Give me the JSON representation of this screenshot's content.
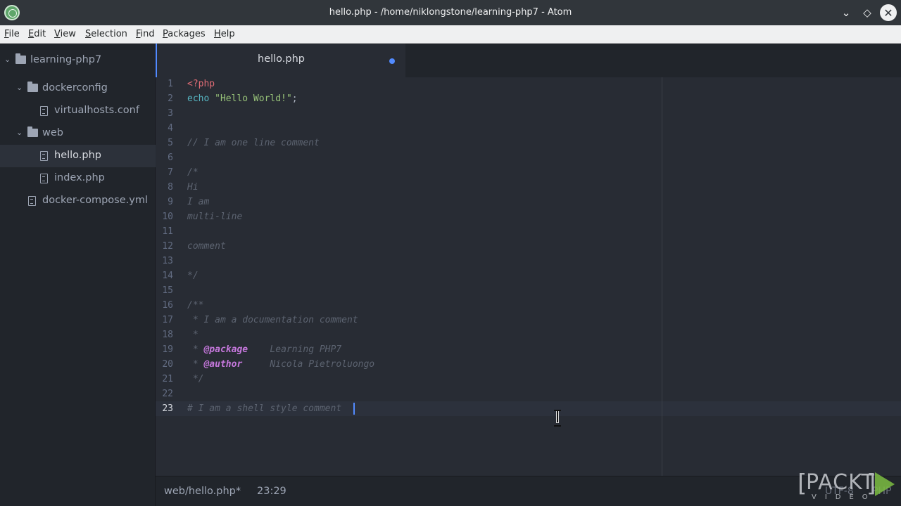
{
  "window": {
    "title": "hello.php - /home/niklongstone/learning-php7 - Atom",
    "buttons": {
      "minimize": "⌄",
      "maximize": "◇",
      "close": "✕"
    }
  },
  "menu": [
    {
      "label": "File",
      "underline": "F",
      "rest": "ile"
    },
    {
      "label": "Edit",
      "underline": "E",
      "rest": "dit"
    },
    {
      "label": "View",
      "underline": "V",
      "rest": "iew"
    },
    {
      "label": "Selection",
      "underline": "S",
      "rest": "election"
    },
    {
      "label": "Find",
      "underline": "F",
      "rest": "ind"
    },
    {
      "label": "Packages",
      "underline": "P",
      "rest": "ackages"
    },
    {
      "label": "Help",
      "underline": "H",
      "rest": "elp"
    }
  ],
  "tree": {
    "items": [
      {
        "label": "learning-php7",
        "type": "folder",
        "expanded": true,
        "icon": "folder-icon"
      },
      {
        "label": "dockerconfig",
        "type": "folder",
        "expanded": true,
        "icon": "folder-icon"
      },
      {
        "label": "virtualhosts.conf",
        "type": "file",
        "icon": "file-icon"
      },
      {
        "label": "web",
        "type": "folder",
        "expanded": true,
        "icon": "folder-icon"
      },
      {
        "label": "hello.php",
        "type": "file",
        "selected": true,
        "icon": "file-icon"
      },
      {
        "label": "index.php",
        "type": "file",
        "icon": "file-icon"
      },
      {
        "label": "docker-compose.yml",
        "type": "file",
        "icon": "file-icon"
      }
    ]
  },
  "tab": {
    "label": "hello.php",
    "modified": true
  },
  "editor": {
    "active_line": 23,
    "line_numbers": [
      "1",
      "2",
      "3",
      "4",
      "5",
      "6",
      "7",
      "8",
      "9",
      "10",
      "11",
      "12",
      "13",
      "14",
      "15",
      "16",
      "17",
      "18",
      "19",
      "20",
      "21",
      "22",
      "23"
    ],
    "lines": {
      "l1": "<?php",
      "l2_kw": "echo",
      "l2_str": "\"Hello World!\"",
      "l2_end": ";",
      "l5": "// I am one line comment",
      "l7": "/*",
      "l8": "Hi",
      "l9": "I am",
      "l10": "multi-line",
      "l12": "comment",
      "l14": "*/",
      "l16": "/**",
      "l17": " * I am a documentation comment",
      "l18": " *",
      "l19_a": " * ",
      "l19_tag": "@package",
      "l19_val": "    Learning PHP7",
      "l20_a": " * ",
      "l20_tag": "@author",
      "l20_val": "     Nicola Pietroluongo",
      "l21": " */",
      "l23": "# I am a shell style comment"
    }
  },
  "status": {
    "file": "web/hello.php*",
    "position": "23:29",
    "encoding": "UTF-8",
    "grammar": "PHP"
  },
  "watermark": {
    "brand": "PACKT",
    "sub": "VIDEO"
  }
}
